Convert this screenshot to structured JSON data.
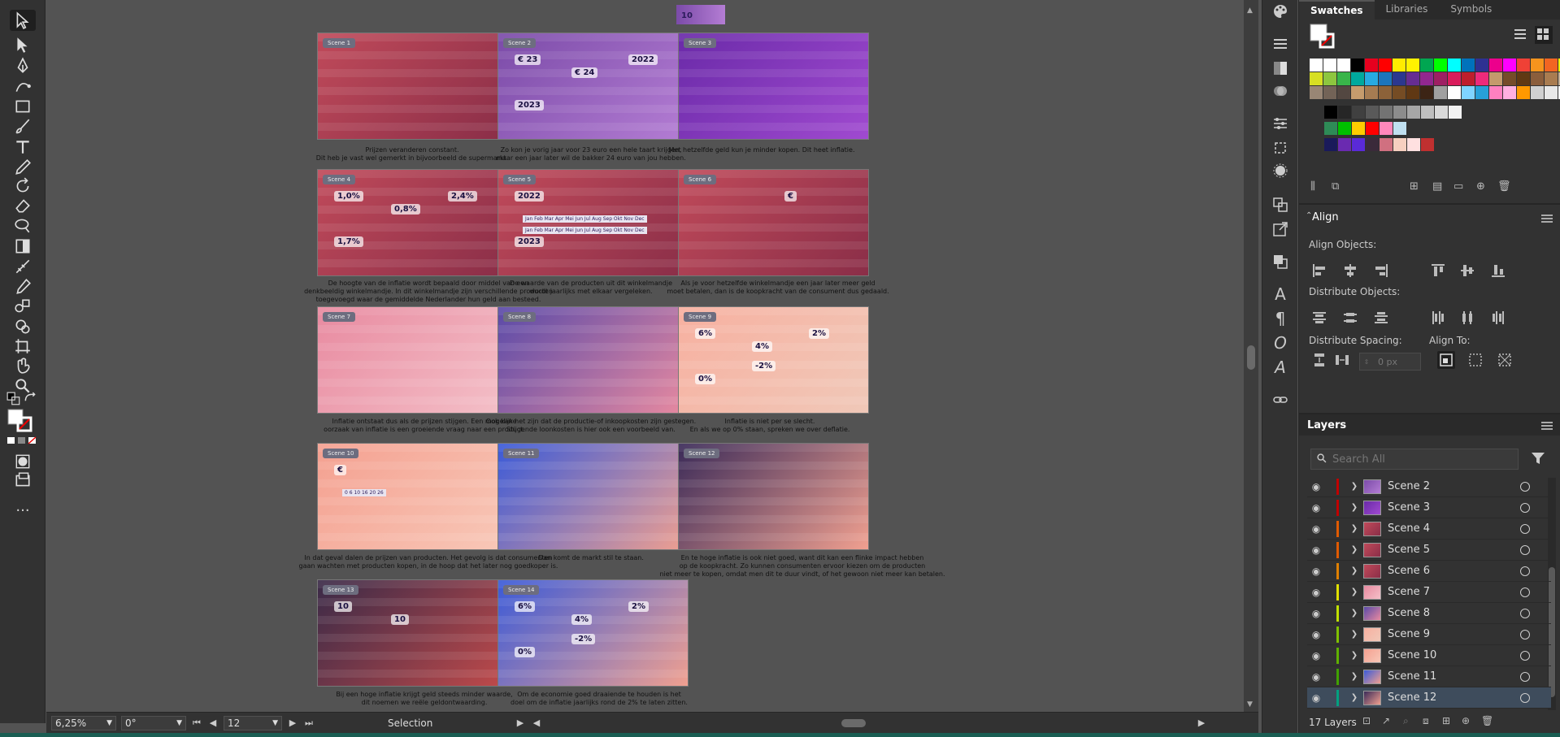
{
  "toolbar": {
    "tools": [
      "selection-tool",
      "direct-selection-tool",
      "pen-tool",
      "curvature-tool",
      "rectangle-tool",
      "paintbrush-tool",
      "type-tool",
      "pencil-tool",
      "rotate-tool",
      "eraser-tool",
      "width-tool",
      "shape-builder-tool",
      "gradient-tool",
      "eyedropper-tool",
      "blend-tool",
      "symbol-sprayer-tool",
      "artboard-tool",
      "slice-tool",
      "zoom-tool"
    ],
    "more_label": "..."
  },
  "canvas": {
    "scenes": [
      {
        "tag": "Scene 1",
        "colors": [
          "#c04a5a",
          "#8a2e48"
        ],
        "caption": "Prijzen veranderen constant.\nDit heb je vast wel gemerkt in bijvoorbeeld de supermarkt."
      },
      {
        "tag": "Scene 2",
        "colors": [
          "#7b4ba8",
          "#b47dd4"
        ],
        "caption": "Zo kon je vorig jaar voor 23 euro een hele taart krijgen,\nmaar een jaar later wil de bakker 24 euro van jou hebben.",
        "labels": [
          "€ 23",
          "€ 24",
          "2022",
          "2023"
        ]
      },
      {
        "tag": "Scene 3",
        "colors": [
          "#6a2aa8",
          "#a04ad0"
        ],
        "caption": "Met hetzelfde geld kun je minder kopen. Dit heet inflatie."
      },
      {
        "tag": "Scene 4",
        "colors": [
          "#c04a5a",
          "#8a2e48"
        ],
        "caption": "De hoogte van de inflatie wordt bepaald door middel van een\ndenkbeeldig winkelmandje. In dit winkelmandje zijn verschillende producten\ntoegevoegd waar de gemiddelde Nederlander hun geld aan besteed.",
        "labels": [
          "1,0%",
          "0,8%",
          "2,4%",
          "1,7%"
        ]
      },
      {
        "tag": "Scene 5",
        "colors": [
          "#c04a5a",
          "#8a2e48"
        ],
        "caption": "De waarde van de producten uit dit winkelmandje\nwordt jaarlijks met elkaar vergeleken.",
        "labels": [
          "2022",
          "Jan Feb Mar Apr Mei Jun Jul Aug Sep Okt Nov Dec",
          "Jan Feb Mar Apr Mei Jun Jul Aug Sep Okt Nov Dec",
          "2023"
        ]
      },
      {
        "tag": "Scene 6",
        "colors": [
          "#c04a5a",
          "#8a2e48"
        ],
        "caption": "Als je voor hetzelfde winkelmandje een jaar later meer geld\nmoet betalen, dan is de koopkracht van de consument dus gedaald.",
        "labels": [
          "€"
        ]
      },
      {
        "tag": "Scene 7",
        "colors": [
          "#e88aa0",
          "#f4c0c8"
        ],
        "caption": "Inflatie ontstaat dus als de prijzen stijgen. Een mogelijke\noorzaak van inflatie is een groeiende vraag naar een product."
      },
      {
        "tag": "Scene 8",
        "colors": [
          "#5a4aa8",
          "#e88aa0"
        ],
        "caption": "Ook kan het zijn dat de productie-of inkoopkosten zijn gestegen.\nStijgende loonkosten is hier ook een voorbeeld van."
      },
      {
        "tag": "Scene 9",
        "colors": [
          "#f7b0a0",
          "#f0c8b8"
        ],
        "caption": "Inflatie is niet per se slecht.\nEn als we op 0% staan, spreken we over deflatie.",
        "labels": [
          "6%",
          "4%",
          "2%",
          "0%",
          "-2%"
        ]
      },
      {
        "tag": "Scene 10",
        "colors": [
          "#f4a090",
          "#f8c8b8"
        ],
        "caption": "In dat geval dalen de prijzen van producten. Het gevolg is dat consumenten\ngaan wachten met producten kopen, in de hoop dat het later nog goedkoper is.",
        "labels": [
          "€",
          "0  6  10  16  20  26"
        ]
      },
      {
        "tag": "Scene 11",
        "colors": [
          "#3a5ad8",
          "#f0a090"
        ],
        "caption": "Dan komt de markt stil te staan."
      },
      {
        "tag": "Scene 12",
        "colors": [
          "#3a2a58",
          "#f0a090"
        ],
        "caption": "En te hoge inflatie is ook niet goed, want dit kan een flinke impact hebben\nop de koopkracht. Zo kunnen consumenten ervoor kiezen om de producten\nniet meer te kopen, omdat men dit te duur vindt, of het gewoon niet meer kan betalen."
      },
      {
        "tag": "Scene 13",
        "colors": [
          "#3a2a48",
          "#c04a4a"
        ],
        "caption": "Bij een hoge inflatie krijgt geld steeds minder waarde,\ndit noemen we reële geldontwaarding.",
        "labels": [
          "10",
          "10"
        ]
      },
      {
        "tag": "Scene 14",
        "colors": [
          "#3a5ad8",
          "#f0a090"
        ],
        "caption": "Om de economie goed draaiende te houden is het\ndoel om de inflatie jaarlijks rond de 2% te laten zitten.",
        "labels": [
          "6%",
          "4%",
          "2%",
          "0%",
          "-2%"
        ]
      }
    ],
    "top_fragment_label": "10"
  },
  "statusbar": {
    "zoom": "6,25%",
    "rotation": "0°",
    "artboard_number": "12",
    "tool_name": "Selection"
  },
  "swatches_panel": {
    "tabs": [
      "Swatches",
      "Libraries",
      "Symbols"
    ],
    "rows": [
      [
        "#ffffff",
        "#ffffff",
        "#ffffff",
        "#000000",
        "#e6001e",
        "#ff0000",
        "#ffeb00",
        "#fff200",
        "#00a651",
        "#00ff00",
        "#00ffff",
        "#0072bc",
        "#2e3192",
        "#ec008c",
        "#ff00ff",
        "#ef4136",
        "#f7941d",
        "#f26522",
        "#fff200"
      ],
      [
        "#d7df23",
        "#8dc63f",
        "#39b54a",
        "#00a99d",
        "#27aae1",
        "#1c75bc",
        "#2b388f",
        "#662d91",
        "#92278f",
        "#9e1f63",
        "#da1c5c",
        "#be1e2d",
        "#ee2a7b",
        "#c49a6c",
        "#754c29",
        "#603913",
        "#8b5e3c",
        "#a97c50",
        "#c7b299"
      ],
      [
        "#998675",
        "#736357",
        "#534741",
        "#c69c6d",
        "#a67c52",
        "#8c6239",
        "#754c24",
        "#603813",
        "#3c2415",
        "#a0a0a0",
        "#ffffff",
        "#7fd4ff",
        "#28a0d8",
        "#ff80c0",
        "#ffb0e0",
        "#ff9900",
        "#d0d0d0",
        "#e8e8e8",
        "#ffffff"
      ]
    ],
    "grey_row": [
      "#000000",
      "#262626",
      "#404040",
      "#595959",
      "#737373",
      "#8c8c8c",
      "#a6a6a6",
      "#bfbfbf",
      "#d9d9d9",
      "#f2f2f2"
    ],
    "group_row_1": [
      "#2e8b57",
      "#00c000",
      "#ffcc00",
      "#ff0000",
      "#ff88bb",
      "#c0e0f0"
    ],
    "group_row_2": [
      "#1a1a5a",
      "#6a2ab0",
      "#5a2ad8",
      "#3a2a3a",
      "#d07080",
      "#f7d0c0",
      "#ffe0e0",
      "#c03030"
    ]
  },
  "align_panel": {
    "title": "Align",
    "align_objects_label": "Align Objects:",
    "distribute_objects_label": "Distribute Objects:",
    "distribute_spacing_label": "Distribute Spacing:",
    "align_to_label": "Align To:",
    "spacing_value": "0 px"
  },
  "layers_panel": {
    "title": "Layers",
    "search_placeholder": "Search All",
    "count_label": "17 Layers",
    "layers": [
      {
        "name": "Scene 2",
        "color": "#c00000"
      },
      {
        "name": "Scene 3",
        "color": "#c00000"
      },
      {
        "name": "Scene 4",
        "color": "#e05a00"
      },
      {
        "name": "Scene 5",
        "color": "#e05a00"
      },
      {
        "name": "Scene 6",
        "color": "#e08000"
      },
      {
        "name": "Scene 7",
        "color": "#e0e000"
      },
      {
        "name": "Scene 8",
        "color": "#c0e000"
      },
      {
        "name": "Scene 9",
        "color": "#80c000"
      },
      {
        "name": "Scene 10",
        "color": "#60b000"
      },
      {
        "name": "Scene 11",
        "color": "#40a000"
      },
      {
        "name": "Scene 12",
        "color": "#00a080",
        "selected": true
      }
    ]
  }
}
